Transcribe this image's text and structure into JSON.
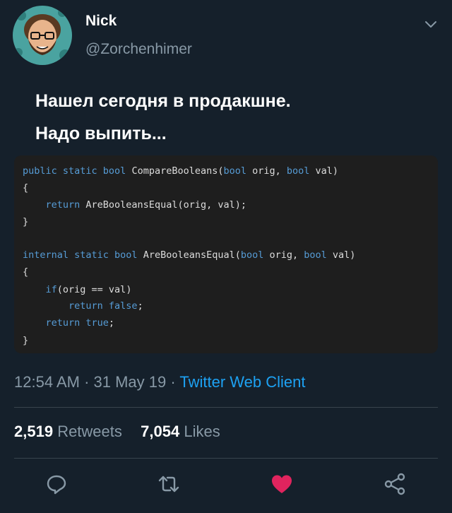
{
  "author": {
    "name": "Nick",
    "handle": "@Zorchenhimer"
  },
  "tweet": {
    "lines": [
      "Нашел сегодня в продакшне.",
      "Надо выпить..."
    ]
  },
  "code": {
    "lines": [
      [
        {
          "t": "public static bool ",
          "k": true
        },
        {
          "t": "CompareBooleans(",
          "k": false
        },
        {
          "t": "bool",
          "k": true
        },
        {
          "t": " orig, ",
          "k": false
        },
        {
          "t": "bool",
          "k": true
        },
        {
          "t": " val)",
          "k": false
        }
      ],
      [
        {
          "t": "{",
          "k": false
        }
      ],
      [
        {
          "t": "    return ",
          "k": true
        },
        {
          "t": "AreBooleansEqual(orig, val);",
          "k": false
        }
      ],
      [
        {
          "t": "}",
          "k": false
        }
      ],
      [],
      [
        {
          "t": "internal static bool ",
          "k": true
        },
        {
          "t": "AreBooleansEqual(",
          "k": false
        },
        {
          "t": "bool",
          "k": true
        },
        {
          "t": " orig, ",
          "k": false
        },
        {
          "t": "bool",
          "k": true
        },
        {
          "t": " val)",
          "k": false
        }
      ],
      [
        {
          "t": "{",
          "k": false
        }
      ],
      [
        {
          "t": "    if",
          "k": true
        },
        {
          "t": "(orig == val)",
          "k": false
        }
      ],
      [
        {
          "t": "        return false",
          "k": true
        },
        {
          "t": ";",
          "k": false
        }
      ],
      [
        {
          "t": "    return true",
          "k": true
        },
        {
          "t": ";",
          "k": false
        }
      ],
      [
        {
          "t": "}",
          "k": false
        }
      ]
    ]
  },
  "meta": {
    "time": "12:54 AM",
    "sep1": " · ",
    "date": "31 May 19",
    "sep2": " · ",
    "client": "Twitter Web Client"
  },
  "stats": {
    "retweets_count": "2,519",
    "retweets_label": "Retweets",
    "likes_count": "7,054",
    "likes_label": "Likes"
  },
  "icons": {
    "reply": "reply-icon",
    "retweet": "retweet-icon",
    "like": "heart-icon",
    "share": "share-icon",
    "caret": "chevron-down-icon"
  },
  "colors": {
    "background": "#15202b",
    "secondary_text": "#8899a6",
    "link": "#1da1f2",
    "like": "#e0245e",
    "code_bg": "#1e1e1e",
    "code_keyword": "#569cd6"
  }
}
